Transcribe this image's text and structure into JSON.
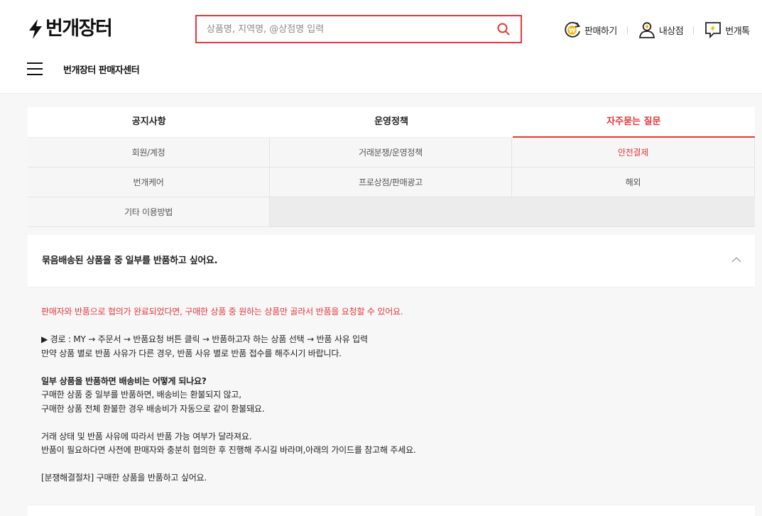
{
  "header": {
    "logo_text": "번개장터",
    "search": {
      "placeholder": "상품명, 지역명, @상점명 입력",
      "value": ""
    },
    "menu": [
      {
        "label": "판매하기",
        "icon": "sell-won-icon"
      },
      {
        "label": "내상점",
        "icon": "person-icon"
      },
      {
        "label": "번개톡",
        "icon": "chat-bolt-icon"
      }
    ]
  },
  "subnav": {
    "title": "번개장터 판매자센터"
  },
  "tabs": [
    {
      "label": "공지사항",
      "active": false
    },
    {
      "label": "운영정책",
      "active": false
    },
    {
      "label": "자주묻는 질문",
      "active": true
    }
  ],
  "categories": [
    {
      "label": "회원/계정",
      "active": false
    },
    {
      "label": "거래분쟁/운영정책",
      "active": false
    },
    {
      "label": "안전결제",
      "active": true
    },
    {
      "label": "번개케어",
      "active": false
    },
    {
      "label": "프로상점/판매광고",
      "active": false
    },
    {
      "label": "해외",
      "active": false
    },
    {
      "label": "기타 이용방법",
      "active": false
    }
  ],
  "faq": {
    "question": "묶음배송된 상품을 중 일부를 반품하고 싶어요.",
    "expanded": true,
    "answer": {
      "highlight": "판매자와 반품으로 협의가 완료되었다면, 구매한 상품 중 원하는 상품만 골라서 반품을 요청할 수 있어요.",
      "route_line1": "▶ 경로 : MY → 주문서 →  반품요청 버튼 클릭 → 반품하고자 하는 상품 선택 → 반품 사유 입력",
      "route_line2": "만약 상품 별로 반품 사유가 다른 경우, 반품 사유 별로 반품 접수를 해주시기 바랍니다.",
      "shipping_title": "일부 상품을 반품하면 배송비는 어떻게 되나요?",
      "shipping_line1": "구매한 상품 중 일부를 반품하면, 배송비는 환불되지 않고,",
      "shipping_line2": "구매한 상품 전체 환불한 경우 배송비가 자동으로 같이 환불돼요.",
      "note_line1": "거래 상태 및 반품 사유에 따라서 반품 가능 여부가 달라져요.",
      "note_line2": "반품이 필요하다면 사전에 판매자와 충분히 협의한 후 진행해 주시길 바라며,아래의 가이드를 참고해 주세요.",
      "link": "[분쟁해결절차] 구매한 상품을 반품하고 싶어요."
    }
  },
  "colors": {
    "accent": "#e5383b",
    "coin": "#f5b400"
  }
}
